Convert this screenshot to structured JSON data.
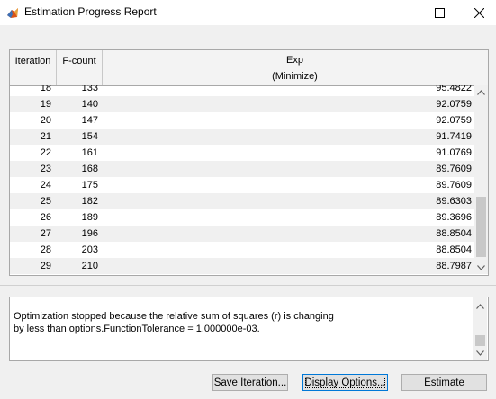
{
  "window": {
    "title": "Estimation Progress Report",
    "icon": "matlab-icon"
  },
  "table": {
    "headers": {
      "iteration": "Iteration",
      "fcount": "F-count",
      "exp_line1": "Exp",
      "exp_line2": "(Minimize)"
    },
    "rows": [
      {
        "iteration": "18",
        "fcount": "133",
        "exp": "95.4822"
      },
      {
        "iteration": "19",
        "fcount": "140",
        "exp": "92.0759"
      },
      {
        "iteration": "20",
        "fcount": "147",
        "exp": "92.0759"
      },
      {
        "iteration": "21",
        "fcount": "154",
        "exp": "91.7419"
      },
      {
        "iteration": "22",
        "fcount": "161",
        "exp": "91.0769"
      },
      {
        "iteration": "23",
        "fcount": "168",
        "exp": "89.7609"
      },
      {
        "iteration": "24",
        "fcount": "175",
        "exp": "89.7609"
      },
      {
        "iteration": "25",
        "fcount": "182",
        "exp": "89.6303"
      },
      {
        "iteration": "26",
        "fcount": "189",
        "exp": "89.3696"
      },
      {
        "iteration": "27",
        "fcount": "196",
        "exp": "88.8504"
      },
      {
        "iteration": "28",
        "fcount": "203",
        "exp": "88.8504"
      },
      {
        "iteration": "29",
        "fcount": "210",
        "exp": "88.7987"
      }
    ]
  },
  "message": {
    "line1": "Optimization stopped because the relative sum of squares (r) is changing",
    "line2": "by less than options.FunctionTolerance = 1.000000e-03."
  },
  "buttons": {
    "save_iteration": "Save Iteration...",
    "display_options": "Display Options...",
    "estimate": "Estimate"
  },
  "colors": {
    "alt_row": "#f0f0f0",
    "focus_border": "#0078d7"
  }
}
